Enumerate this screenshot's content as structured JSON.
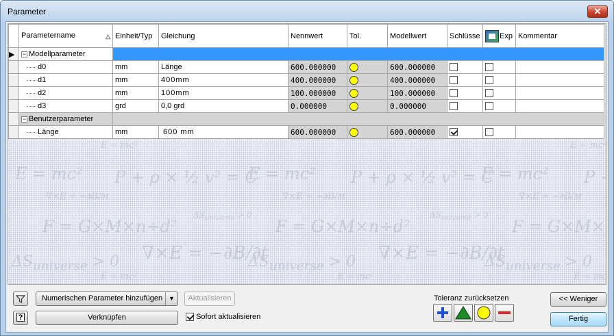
{
  "window": {
    "title": "Parameter",
    "close_glyph": "✕"
  },
  "columns": {
    "name": "Parametername",
    "unit": "Einheit/Typ",
    "equation": "Gleichung",
    "nominal": "Nennwert",
    "tol": "Tol.",
    "model": "Modellwert",
    "key": "Schlüsse",
    "exp": "Exp",
    "comment": "Kommentar"
  },
  "groups": {
    "model": {
      "label": "Modellparameter"
    },
    "user": {
      "label": "Benutzerparameter"
    }
  },
  "model_rows": [
    {
      "name": "d0",
      "unit": "mm",
      "equation": "Länge",
      "nominal": "600.000000",
      "model": "600.000000",
      "key": false,
      "exp": false
    },
    {
      "name": "d1",
      "unit": "mm",
      "equation": "400mm",
      "nominal": "400.000000",
      "model": "400.000000",
      "key": false,
      "exp": false
    },
    {
      "name": "d2",
      "unit": "mm",
      "equation": "100mm",
      "nominal": "100.000000",
      "model": "100.000000",
      "key": false,
      "exp": false
    },
    {
      "name": "d3",
      "unit": "grd",
      "equation": "0,0 grd",
      "nominal": "0.000000",
      "model": "0.000000",
      "key": false,
      "exp": false
    }
  ],
  "user_rows": [
    {
      "name": "Länge",
      "unit": "mm",
      "equation": "600 mm",
      "nominal": "600.000000",
      "model": "600.000000",
      "key": true,
      "exp": false
    }
  ],
  "toolbar": {
    "add_numeric": "Numerischen Parameter hinzufügen",
    "update": "Aktualisieren",
    "link": "Verknüpfen",
    "auto_update": "Sofort aktualisieren",
    "auto_update_checked": true,
    "help_glyph": "?"
  },
  "tolerance": {
    "title": "Toleranz zurücksetzen"
  },
  "buttons": {
    "less": "<< Weniger",
    "done": "Fertig"
  },
  "colors": {
    "selection": "#3399ff",
    "tol_indicator": "#ffff00",
    "plus": "#1f4fd6",
    "triangle": "#1d8a2a",
    "minus": "#d92b2b"
  },
  "icons": [
    "filter-icon",
    "help-icon",
    "export-parameter-icon",
    "tolerance-upper-icon",
    "tolerance-median-icon",
    "tolerance-nominal-icon",
    "tolerance-lower-icon",
    "dropdown-arrow-icon"
  ]
}
